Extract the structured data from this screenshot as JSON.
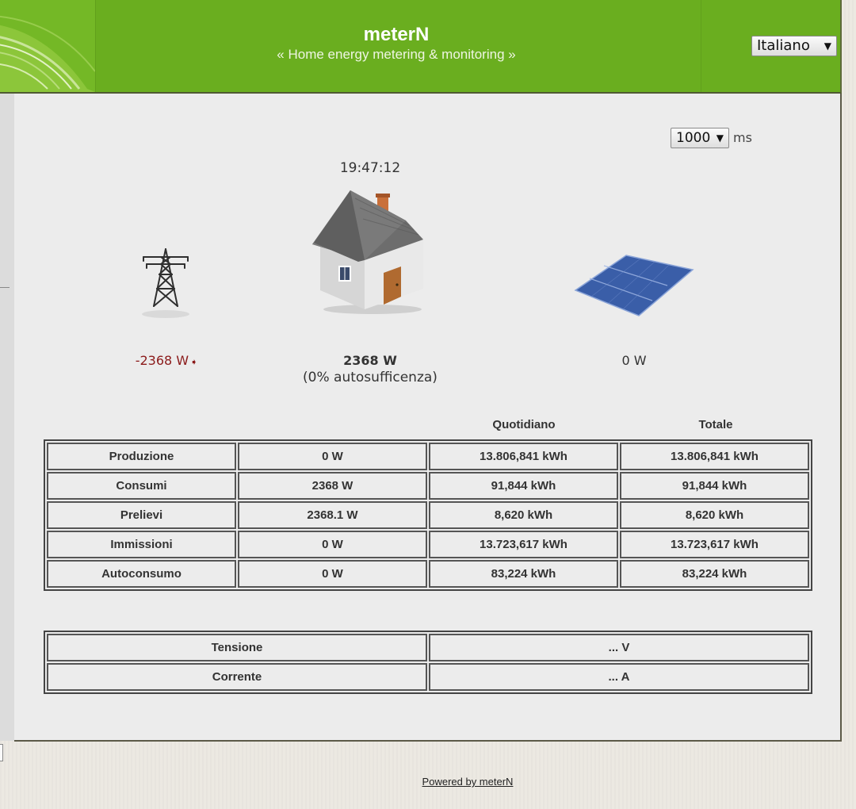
{
  "header": {
    "title": "meterN",
    "subtitle": "« Home energy metering & monitoring »",
    "language": "Italiano"
  },
  "refresh": {
    "value": "1000",
    "unit": "ms"
  },
  "live": {
    "time": "19:47:12",
    "grid_power": "-2368 W",
    "house_power": "2368 W",
    "self_sufficiency": "(0% autosufficenza)",
    "solar_power": "0 W"
  },
  "energy_table": {
    "headers": [
      "",
      "",
      "Quotidiano",
      "Totale"
    ],
    "rows": [
      [
        "Produzione",
        "0 W",
        "13.806,841 kWh",
        "13.806,841 kWh"
      ],
      [
        "Consumi",
        "2368 W",
        "91,844 kWh",
        "91,844 kWh"
      ],
      [
        "Prelievi",
        "2368.1 W",
        "8,620 kWh",
        "8,620 kWh"
      ],
      [
        "Immissioni",
        "0 W",
        "13.723,617 kWh",
        "13.723,617 kWh"
      ],
      [
        "Autoconsumo",
        "0 W",
        "83,224 kWh",
        "83,224 kWh"
      ]
    ]
  },
  "electrical_table": {
    "rows": [
      [
        "Tensione",
        "... V"
      ],
      [
        "Corrente",
        "... A"
      ]
    ]
  },
  "footer": {
    "link": "Powered by meterN"
  },
  "icons": {
    "pylon": "power-pylon-icon",
    "house": "house-icon",
    "solar": "solar-panel-icon",
    "flow": "flow-arrow-icon"
  },
  "colors": {
    "header_green": "#6aae1f",
    "grid_import": "#8b1a1a"
  }
}
